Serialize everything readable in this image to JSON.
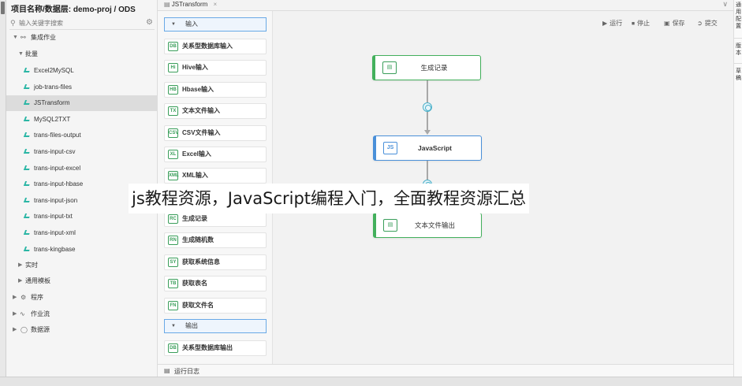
{
  "project": {
    "title": "项目名称/数据层:   demo-proj / ODS",
    "search_placeholder": "输入关键字搜索"
  },
  "tree": {
    "root": "集成作业",
    "batch": "批量",
    "leaves": [
      "Excel2MySQL",
      "job-trans-files",
      "JSTransform",
      "MySQL2TXT",
      "trans-files-output",
      "trans-input-csv",
      "trans-input-excel",
      "trans-input-hbase",
      "trans-input-json",
      "trans-input-txt",
      "trans-input-xml",
      "trans-kingbase"
    ],
    "selected": "JSTransform",
    "realtime": "实时",
    "template": "通用模板",
    "program": "程序",
    "workflow": "作业流",
    "datasource": "数据源"
  },
  "tab": {
    "label": "JSTransform",
    "close": "×"
  },
  "toolbar": {
    "run": "运行",
    "stop": "停止",
    "save": "保存",
    "submit": "提交"
  },
  "palette": {
    "input_section": "输入",
    "input_items": [
      "关系型数据库输入",
      "Hive输入",
      "Hbase输入",
      "文本文件输入",
      "CSV文件输入",
      "Excel输入",
      "XML输入"
    ],
    "gen_items": [
      "生成记录",
      "生成随机数",
      "获取系统信息",
      "获取表名",
      "获取文件名"
    ],
    "output_section": "输出",
    "output_items": [
      "关系型数据库输出"
    ]
  },
  "nodes": {
    "gen": "生成记录",
    "js": "JavaScript",
    "js_icon": "JS",
    "txt": "文本文件输出"
  },
  "right_panel": {
    "t1": "通用配置",
    "t2": "版本",
    "t3": "草稿"
  },
  "log": {
    "label": "运行日志"
  },
  "overlay": {
    "text": "js教程资源，JavaScript编程入门，全面教程资源汇总"
  },
  "icons": {
    "search": "search-icon",
    "gear": "gear-icon",
    "run": "play-icon",
    "stop": "stop-icon",
    "save": "save-icon",
    "submit": "submit-icon"
  },
  "colors": {
    "accent_blue": "#4a90d9",
    "green": "#43b05c",
    "teal": "#2bb6a5"
  }
}
